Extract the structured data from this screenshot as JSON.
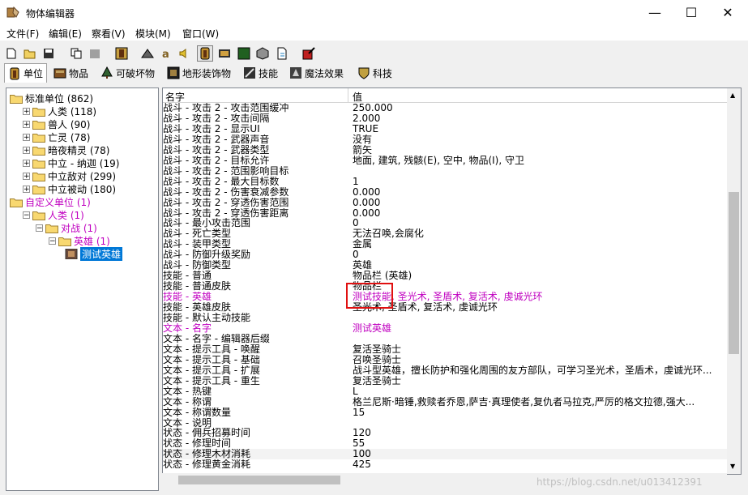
{
  "window": {
    "title": "物体编辑器",
    "min": "—",
    "max": "☐",
    "close": "✕"
  },
  "menu": [
    "文件(F)",
    "编辑(E)",
    "察看(V)",
    "模块(M)",
    "窗口(W)"
  ],
  "tabs": [
    {
      "label": "单位",
      "active": true
    },
    {
      "label": "物品",
      "active": false
    },
    {
      "label": "可破坏物",
      "active": false
    },
    {
      "label": "地形装饰物",
      "active": false
    },
    {
      "label": "技能",
      "active": false
    },
    {
      "label": "魔法效果",
      "active": false
    },
    {
      "label": "科技",
      "active": false
    }
  ],
  "tree": [
    {
      "label": "标准单位 (862)",
      "indent": 0,
      "expander": "open",
      "custom": false
    },
    {
      "label": "人类 (118)",
      "indent": 1,
      "expander": "+",
      "custom": false
    },
    {
      "label": "兽人 (90)",
      "indent": 1,
      "expander": "+",
      "custom": false
    },
    {
      "label": "亡灵 (78)",
      "indent": 1,
      "expander": "+",
      "custom": false
    },
    {
      "label": "暗夜精灵 (78)",
      "indent": 1,
      "expander": "+",
      "custom": false
    },
    {
      "label": "中立 - 纳迦 (19)",
      "indent": 1,
      "expander": "+",
      "custom": false
    },
    {
      "label": "中立敌对 (299)",
      "indent": 1,
      "expander": "+",
      "custom": false
    },
    {
      "label": "中立被动 (180)",
      "indent": 1,
      "expander": "+",
      "custom": false
    },
    {
      "label": "自定义单位 (1)",
      "indent": 0,
      "expander": "open",
      "custom": true
    },
    {
      "label": "人类 (1)",
      "indent": 1,
      "expander": "-",
      "custom": true
    },
    {
      "label": "对战 (1)",
      "indent": 2,
      "expander": "-",
      "custom": true
    },
    {
      "label": "英雄 (1)",
      "indent": 3,
      "expander": "-",
      "custom": true
    },
    {
      "label": "测试英雄",
      "indent": 4,
      "expander": "none",
      "custom": false,
      "selected": true
    }
  ],
  "grid": {
    "col_name": "名字",
    "col_value": "值",
    "rows": [
      {
        "name": "战斗 - 攻击 2 - 攻击范围缓冲",
        "value": "250.000"
      },
      {
        "name": "战斗 - 攻击 2 - 攻击间隔",
        "value": "2.000"
      },
      {
        "name": "战斗 - 攻击 2 - 显示UI",
        "value": "TRUE"
      },
      {
        "name": "战斗 - 攻击 2 - 武器声音",
        "value": "没有"
      },
      {
        "name": "战斗 - 攻击 2 - 武器类型",
        "value": "箭矢"
      },
      {
        "name": "战斗 - 攻击 2 - 目标允许",
        "value": "地面, 建筑, 残骸(E), 空中, 物品(I), 守卫"
      },
      {
        "name": "战斗 - 攻击 2 - 范围影响目标",
        "value": ""
      },
      {
        "name": "战斗 - 攻击 2 - 最大目标数",
        "value": "1"
      },
      {
        "name": "战斗 - 攻击 2 - 伤害衰减参数",
        "value": "0.000"
      },
      {
        "name": "战斗 - 攻击 2 - 穿透伤害范围",
        "value": "0.000"
      },
      {
        "name": "战斗 - 攻击 2 - 穿透伤害距离",
        "value": "0.000"
      },
      {
        "name": "战斗 - 最小攻击范围",
        "value": "0"
      },
      {
        "name": "战斗 - 死亡类型",
        "value": "无法召唤,会腐化"
      },
      {
        "name": "战斗 - 装甲类型",
        "value": "金属"
      },
      {
        "name": "战斗 - 防御升级奖励",
        "value": "0"
      },
      {
        "name": "战斗 - 防御类型",
        "value": "英雄"
      },
      {
        "name": "技能 - 普通",
        "value": "物品栏 (英雄)"
      },
      {
        "name": "技能 - 普通皮肤",
        "value": "物品栏"
      },
      {
        "name": "技能 - 英雄",
        "value": "测试技能, 圣光术, 圣盾术, 复活术, 虔诚光环",
        "custom": true
      },
      {
        "name": "技能 - 英雄皮肤",
        "value": "圣光术, 圣盾术, 复活术, 虔诚光环"
      },
      {
        "name": "技能 - 默认主动技能",
        "value": ""
      },
      {
        "name": "文本 - 名字",
        "value": "测试英雄",
        "custom": true
      },
      {
        "name": "文本 - 名字 - 编辑器后缀",
        "value": ""
      },
      {
        "name": "文本 - 提示工具 - 唤醒",
        "value": "复活圣骑士"
      },
      {
        "name": "文本 - 提示工具 - 基础",
        "value": "召唤圣骑士"
      },
      {
        "name": "文本 - 提示工具 - 扩展",
        "value": "战斗型英雄，擅长防护和强化周围的友方部队，可学习圣光术，圣盾术，虔诚光环..."
      },
      {
        "name": "文本 - 提示工具 - 重生",
        "value": "复活圣骑士"
      },
      {
        "name": "文本 - 热键",
        "value": "L"
      },
      {
        "name": "文本 - 称谓",
        "value": "格兰尼斯·暗锤,救赎者乔恩,萨吉·真理使者,复仇者马拉克,严厉的格文拉德,强大..."
      },
      {
        "name": "文本 - 称谓数量",
        "value": "15"
      },
      {
        "name": "文本 - 说明",
        "value": ""
      },
      {
        "name": "状态 - 佣兵招募时间",
        "value": "120"
      },
      {
        "name": "状态 - 修理时间",
        "value": "55"
      },
      {
        "name": "状态 - 修理木材消耗",
        "value": "100"
      },
      {
        "name": "状态 - 修理黄金消耗",
        "value": "425"
      }
    ]
  },
  "watermark": "https://blog.csdn.net/u013412391"
}
